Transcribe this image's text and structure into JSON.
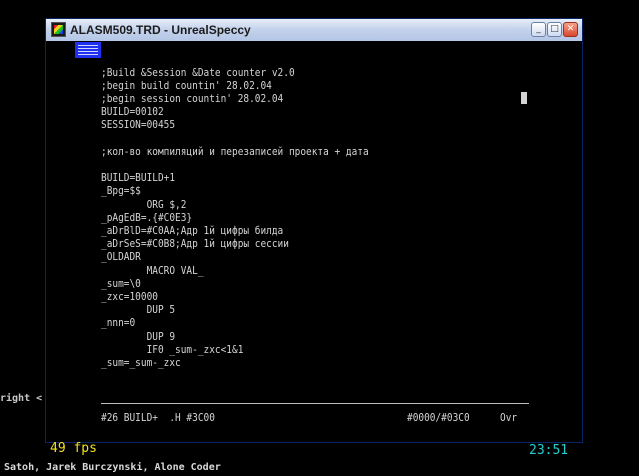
{
  "window": {
    "title": "ALASM509.TRD - UnrealSpeccy",
    "minimize_glyph": "_",
    "maximize_glyph": "□",
    "close_glyph": "✕",
    "accent": "#0831d9"
  },
  "code_lines": [
    {
      "row": 2,
      "text": ";Build &Session &Date counter v2.0"
    },
    {
      "row": 3,
      "text": ";begin build countin' 28.02.04"
    },
    {
      "row": 4,
      "text": ";begin session countin' 28.02.04"
    },
    {
      "row": 5,
      "text": "BUILD=00102"
    },
    {
      "row": 6,
      "text": "SESSION=00455"
    },
    {
      "row": 8,
      "text": ";кол-во компиляций и перезаписей проекта + дата"
    },
    {
      "row": 10,
      "text": "BUILD=BUILD+1"
    },
    {
      "row": 11,
      "text": "_Bpg=$$"
    },
    {
      "row": 12,
      "text": "        ORG $,2"
    },
    {
      "row": 13,
      "text": "_pAgEdB=.{#C0E3}"
    },
    {
      "row": 14,
      "text": "_aDrBlD=#C0AA;Адр 1й цифры билда"
    },
    {
      "row": 15,
      "text": "_aDrSeS=#C0B8;Адр 1й цифры сессии"
    },
    {
      "row": 16,
      "text": "_OLDADR"
    },
    {
      "row": 17,
      "text": "        MACRO VAL_"
    },
    {
      "row": 18,
      "text": "_sum=\\0"
    },
    {
      "row": 19,
      "text": "_zxc=10000"
    },
    {
      "row": 20,
      "text": "        DUP 5"
    },
    {
      "row": 21,
      "text": "_nnn=0"
    },
    {
      "row": 22,
      "text": "        DUP 9"
    },
    {
      "row": 23,
      "text": "        IF0 _sum-_zxc<1&1"
    },
    {
      "row": 24,
      "text": "_sum=_sum-_zxc"
    }
  ],
  "status": {
    "left": "#26 BUILD+  .H #3C00",
    "address": "#0000/#03C0",
    "mode": "Ovr"
  },
  "overlay": {
    "fps": "49 fps",
    "clock": "23:51"
  },
  "desktop": {
    "left_text": "right <",
    "bottom_text": "Satoh, Jarek Burczynski, Alone Coder"
  }
}
